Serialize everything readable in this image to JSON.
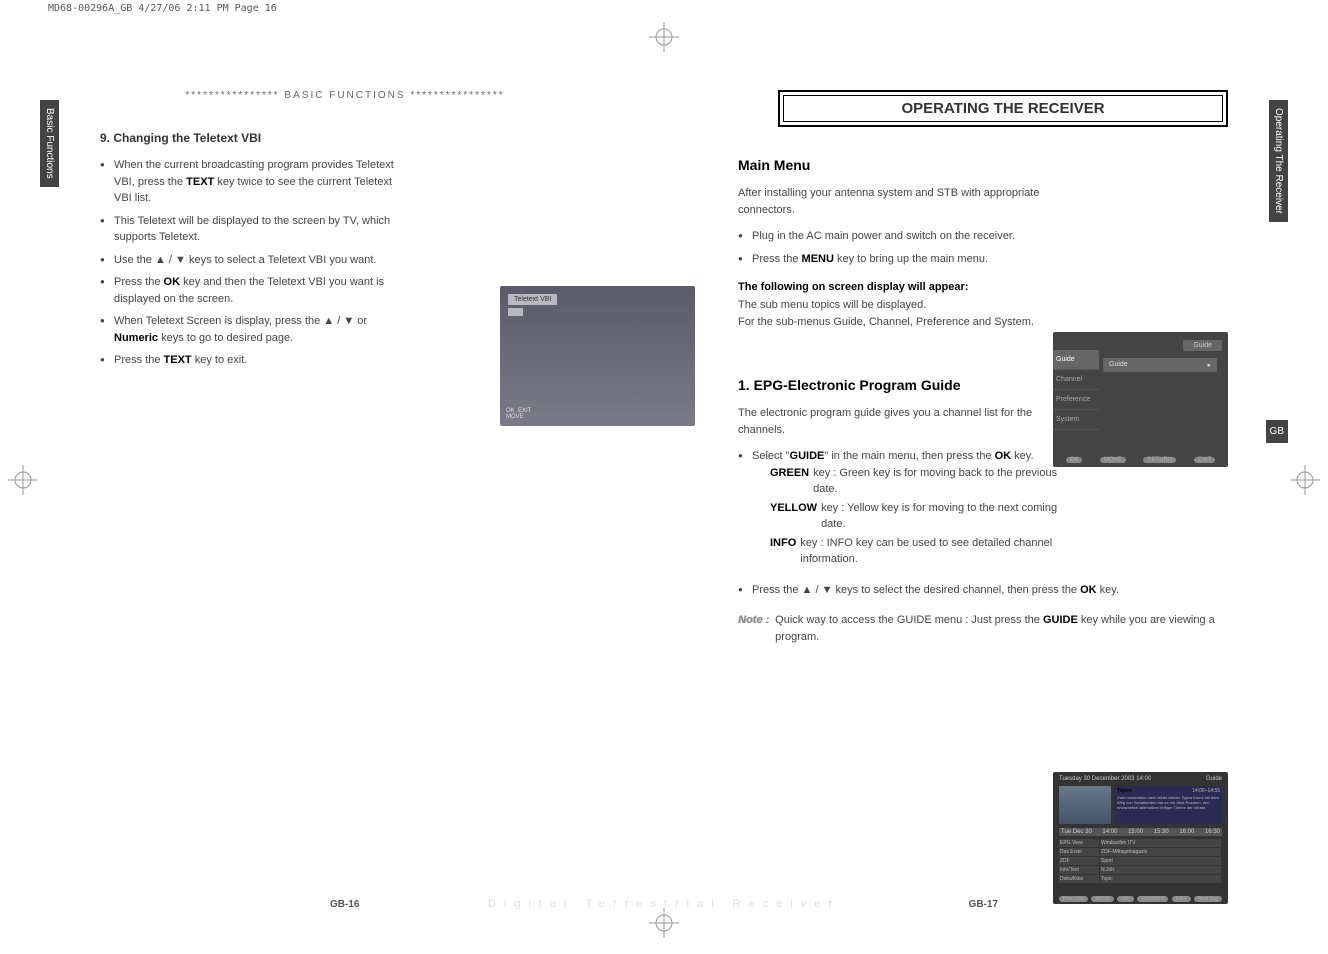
{
  "header": "MD68-00296A_GB  4/27/06  2:11 PM  Page 16",
  "side_tabs": {
    "left": "Basic Functions",
    "right": "Operating The Receiver",
    "gb": "GB"
  },
  "left": {
    "section_header": "****************   BASIC FUNCTIONS   ****************",
    "h1": "9. Changing the Teletext VBI",
    "bullets": [
      "When the current broadcasting program provides Teletext VBI, press the <b>TEXT</b> key twice to see the current Teletext VBI list.",
      "This Teletext will be displayed to the screen by TV, which supports Teletext.",
      "Use the ▲ / ▼ keys to select a Teletext VBI you want.",
      "Press the <b>OK</b> key and then the Teletext VBI you want is displayed on the screen.",
      "When Teletext Screen is display, press the ▲ / ▼ or <b>Numeric</b> keys to go to desired page.",
      "Press the <b>TEXT</b> key to exit."
    ],
    "shot_banner": "Teletext VBI",
    "shot_footer": "OK  EXIT\nMOVE"
  },
  "right": {
    "title_box": "OPERATING THE RECEIVER",
    "section1": {
      "head": "Main Menu",
      "intro": "After installing your antenna system and STB with appropriate connectors.",
      "bullets": [
        "Plug in the AC main power and switch on the receiver.",
        "Press the <b>MENU</b> key to bring up the main menu."
      ],
      "bold_line": "The following on screen display will appear:",
      "after": "The sub menu topics will be displayed.\nFor the sub-menus Guide, Channel, Preference and System."
    },
    "shot2": {
      "topbar": "Guide",
      "nav": [
        "Guide",
        "Channel",
        "Preference",
        "System"
      ],
      "row_label": "Guide",
      "row_arrow": "▸",
      "bot": [
        "OK",
        "MOVE",
        "RETURN",
        "EXIT"
      ]
    },
    "section2": {
      "head": "1. EPG-Electronic Program Guide",
      "intro": "The electronic program guide gives you a channel list for the channels.",
      "bullet1": "Select \"<b>GUIDE</b>\" in the main menu, then press the <b>OK</b> key.",
      "keys": [
        {
          "name": "GREEN",
          "text": "key : Green key is for moving back to the previous date."
        },
        {
          "name": "YELLOW",
          "text": "key : Yellow key is for moving to the next coming date."
        },
        {
          "name": "INFO",
          "text": "key : INFO key can be used to see detailed channel information."
        }
      ],
      "bullet2": "Press the ▲ / ▼ keys to select the desired channel, then press the <b>OK</b> key.",
      "note_label": "Note :",
      "note": "Quick way to access the GUIDE menu : Just press the <b>GUIDE</b> key while you are viewing a program."
    },
    "shot3": {
      "top_date": "Tuesday 30 December 2003 14:00",
      "top_right": "Guide",
      "info_title": "Tigers",
      "info_time": "14:00–14:55",
      "info_body": "Zwei moderation nach leider wieder Tigers Koms bei dem Weg von Schafherden hat es mit Jetzt Rochem, den erwachelich aklimatizen kritiger Theme der Infrast.",
      "date_row": {
        "label": "Tue Dec 30",
        "times": [
          "14:00",
          "15:00",
          "15:30",
          "16:00",
          "16:30"
        ]
      },
      "channels": [
        "EPG View",
        "Das Erste",
        "ZDF",
        "Info/Text",
        "Doku/Kika"
      ],
      "programs": [
        "Windsurfen ITV",
        "ZDF-Mittagsmagazin",
        "Sport",
        "N.Joh",
        "Topic"
      ],
      "bot_left": "Prev. Day",
      "bot_right": "Next Day",
      "botbar": [
        "MOVE",
        "Info",
        "TV/RADIO",
        "EXIT"
      ]
    }
  },
  "footer": {
    "left_num": "GB-16",
    "right_num": "GB-17",
    "brand": "Digital Terrestrial Receiver"
  }
}
